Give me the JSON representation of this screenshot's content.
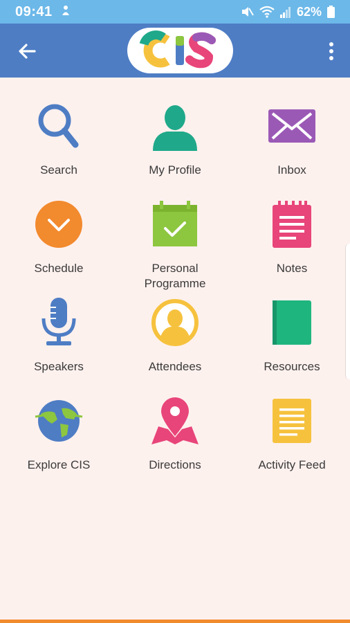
{
  "status": {
    "time": "09:41",
    "battery": "62%"
  },
  "app": {
    "logo_text": "CIS"
  },
  "menu": [
    {
      "label": "Search",
      "icon": "search-icon",
      "color": "#4e7dc4"
    },
    {
      "label": "My Profile",
      "icon": "person-icon",
      "color": "#1fa98a"
    },
    {
      "label": "Inbox",
      "icon": "envelope-icon",
      "color": "#9b59b6"
    },
    {
      "label": "Schedule",
      "icon": "clock-icon",
      "color": "#f28a2e"
    },
    {
      "label": "Personal\nProgramme",
      "icon": "calendar-check-icon",
      "color": "#8dc63f"
    },
    {
      "label": "Notes",
      "icon": "notepad-icon",
      "color": "#e8457a"
    },
    {
      "label": "Speakers",
      "icon": "microphone-icon",
      "color": "#4e7dc4"
    },
    {
      "label": "Attendees",
      "icon": "attendee-icon",
      "color": "#f6c23e"
    },
    {
      "label": "Resources",
      "icon": "book-icon",
      "color": "#1fb57f"
    },
    {
      "label": "Explore CIS",
      "icon": "globe-icon",
      "color": "#4e7dc4"
    },
    {
      "label": "Directions",
      "icon": "map-pin-icon",
      "color": "#e8457a"
    },
    {
      "label": "Activity Feed",
      "icon": "document-icon",
      "color": "#f6c23e"
    }
  ],
  "colors": {
    "status_bar": "#6cb8e9",
    "app_bar": "#4e7dc4",
    "background": "#fdf1ee",
    "accent_bottom": "#f28a2e"
  }
}
